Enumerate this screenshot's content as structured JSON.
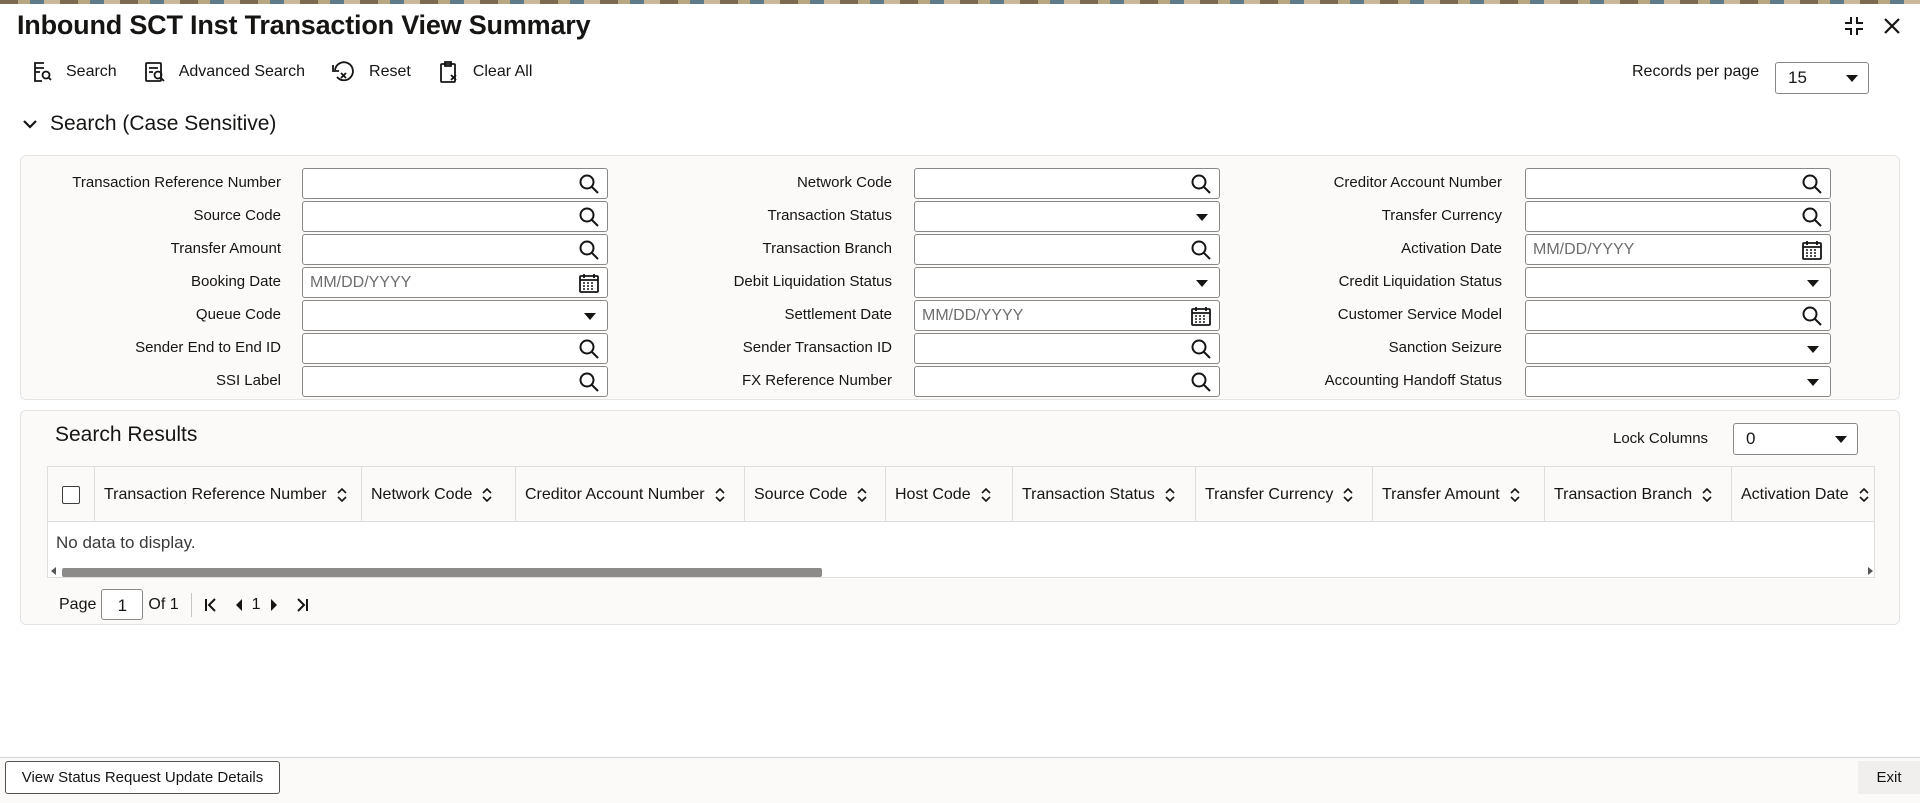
{
  "window": {
    "title": "Inbound SCT Inst Transaction View Summary"
  },
  "toolbar": {
    "search": "Search",
    "advanced_search": "Advanced Search",
    "reset": "Reset",
    "clear_all": "Clear All"
  },
  "records_per_page": {
    "label": "Records per page",
    "value": "15"
  },
  "search_section": {
    "title": "Search (Case Sensitive)"
  },
  "fields": {
    "transaction_reference_number": {
      "label": "Transaction Reference Number",
      "value": ""
    },
    "source_code": {
      "label": "Source Code",
      "value": ""
    },
    "transfer_amount": {
      "label": "Transfer Amount",
      "value": ""
    },
    "booking_date": {
      "label": "Booking Date",
      "placeholder": "MM/DD/YYYY"
    },
    "queue_code": {
      "label": "Queue Code",
      "value": ""
    },
    "sender_end_to_end_id": {
      "label": "Sender End to End ID",
      "value": ""
    },
    "ssi_label": {
      "label": "SSI Label",
      "value": ""
    },
    "network_code": {
      "label": "Network Code",
      "value": ""
    },
    "transaction_status": {
      "label": "Transaction Status",
      "value": ""
    },
    "transaction_branch": {
      "label": "Transaction Branch",
      "value": ""
    },
    "debit_liquidation_status": {
      "label": "Debit Liquidation Status",
      "value": ""
    },
    "settlement_date": {
      "label": "Settlement Date",
      "placeholder": "MM/DD/YYYY"
    },
    "sender_transaction_id": {
      "label": "Sender Transaction ID",
      "value": ""
    },
    "fx_reference_number": {
      "label": "FX Reference Number",
      "value": ""
    },
    "creditor_account_number": {
      "label": "Creditor Account Number",
      "value": ""
    },
    "transfer_currency": {
      "label": "Transfer Currency",
      "value": ""
    },
    "activation_date": {
      "label": "Activation Date",
      "placeholder": "MM/DD/YYYY"
    },
    "credit_liquidation_status": {
      "label": "Credit Liquidation Status",
      "value": ""
    },
    "customer_service_model": {
      "label": "Customer Service Model",
      "value": ""
    },
    "sanction_seizure": {
      "label": "Sanction Seizure",
      "value": ""
    },
    "accounting_handoff_status": {
      "label": "Accounting Handoff Status",
      "value": ""
    }
  },
  "results": {
    "title": "Search Results",
    "lock_columns": {
      "label": "Lock Columns",
      "value": "0"
    },
    "columns": [
      "Transaction Reference Number",
      "Network Code",
      "Creditor Account Number",
      "Source Code",
      "Host Code",
      "Transaction Status",
      "Transfer Currency",
      "Transfer Amount",
      "Transaction Branch",
      "Activation Date"
    ],
    "empty_message": "No data to display."
  },
  "pagination": {
    "page_label": "Page",
    "page_value": "1",
    "of_label": "Of 1",
    "current": "1"
  },
  "footer": {
    "view_status_button": "View Status Request Update Details",
    "exit_button": "Exit"
  }
}
